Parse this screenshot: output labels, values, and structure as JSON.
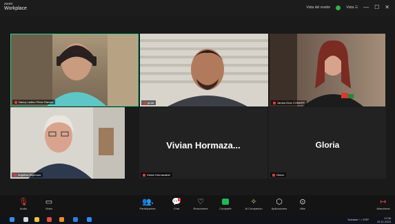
{
  "app": {
    "brand_top": "zoom",
    "brand_name": "Workplace"
  },
  "titlebar": {
    "view_speaker_label": "Vista del orador",
    "view_label": "Vista ☷",
    "minimize": "—",
    "maximize": "☐",
    "close": "✕"
  },
  "participants": [
    {
      "name": "Nancy Ladino Pérez Ramos"
    },
    {
      "name": "gruta"
    },
    {
      "name": "Janara Díaz COMAPE"
    },
    {
      "name": "Angélica Espinoza"
    },
    {
      "name": "Vivian Hormazabal",
      "display": "Vivian  Hormaza..."
    },
    {
      "name": "Gloria",
      "display": "Gloria"
    }
  ],
  "toolbar": {
    "audio": "Audio",
    "video": "Video",
    "participants": "Participantes",
    "participants_count": "6",
    "chat": "Chat",
    "chat_badge": "1",
    "reactions": "Reacciones",
    "share": "Compartir",
    "ai_companion": "AI Companion",
    "apps": "Aplicaciones",
    "more": "Más",
    "leave": "Abandonar"
  },
  "colors": {
    "active_speaker_border": "#2fd18a",
    "muted": "#e53935",
    "share_green": "#1db954"
  },
  "taskbar": {
    "tray_weather": "Nublado",
    "tray_lang": "ESP",
    "time": "17:06",
    "date": "10-11-2024"
  }
}
